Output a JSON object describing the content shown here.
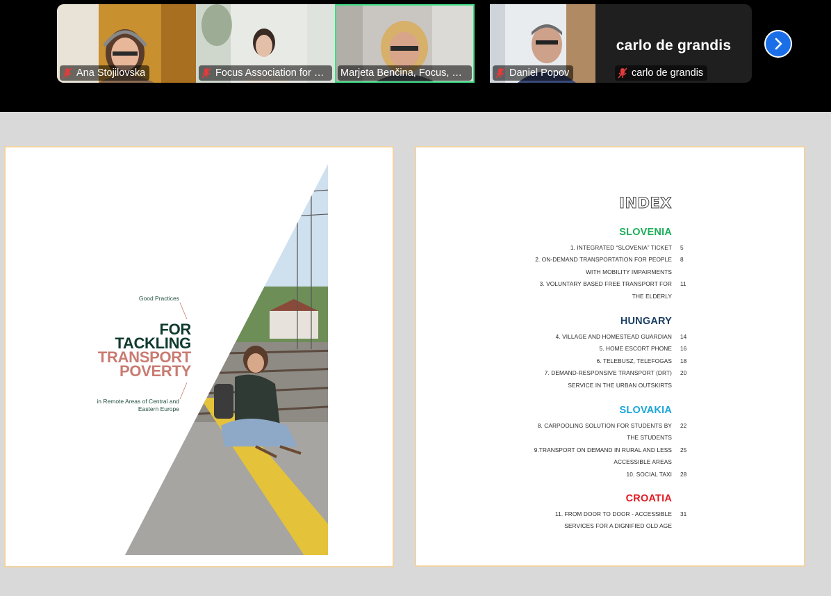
{
  "participants": [
    {
      "name": "Ana Stojilovska",
      "muted": true
    },
    {
      "name": "Focus Association for Sustainable Development",
      "muted": true
    },
    {
      "name": "Marjeta Benčina, Focus, Slovenia",
      "muted": false,
      "active_speaker": true
    },
    {
      "name": "Daniel Popov",
      "muted": true
    },
    {
      "name": "carlo de grandis",
      "display_name": "carlo de grandis",
      "muted": true,
      "video_off": true
    }
  ],
  "colors": {
    "active_speaker_border": "#3ddc84",
    "nav_button": "#1a6fe8",
    "slovenia": "#1fae5b",
    "hungary": "#1b3f63",
    "slovakia": "#1aa5db",
    "croatia": "#e11b22",
    "cover_green": "#0f3b2e",
    "cover_pink": "#c97b72",
    "page_border": "#f2d3a3"
  },
  "cover": {
    "kicker": "Good Practices",
    "line1": "FOR",
    "line2": "TACKLING",
    "line3": "TRANSPORT",
    "line4": "POVERTY",
    "subtitle": "in Remote Areas of Central and Eastern Europe"
  },
  "index": {
    "title": "INDEX",
    "sections": [
      {
        "country": "SLOVENIA",
        "entries": [
          {
            "lines": [
              "1. INTEGRATED “SLOVENIA” TICKET"
            ],
            "page": "5"
          },
          {
            "lines": [
              "2. ON-DEMAND TRANSPORTATION FOR PEOPLE",
              "WITH MOBILITY IMPAIRMENTS"
            ],
            "page": "8"
          },
          {
            "lines": [
              "3. VOLUNTARY BASED FREE TRANSPORT FOR",
              "THE ELDERLY"
            ],
            "page": "11"
          }
        ]
      },
      {
        "country": "HUNGARY",
        "entries": [
          {
            "lines": [
              "4. VILLAGE AND HOMESTEAD GUARDIAN"
            ],
            "page": "14"
          },
          {
            "lines": [
              "5. HOME ESCORT PHONE"
            ],
            "page": "16"
          },
          {
            "lines": [
              "6. TELEBUSZ, TELEFOGAS"
            ],
            "page": "18"
          },
          {
            "lines": [
              "7. DEMAND-RESPONSIVE TRANSPORT (DRT)",
              "SERVICE IN THE URBAN OUTSKIRTS"
            ],
            "page": "20"
          }
        ]
      },
      {
        "country": "SLOVAKIA",
        "entries": [
          {
            "lines": [
              "8. CARPOOLING SOLUTION FOR STUDENTS BY",
              "THE STUDENTS"
            ],
            "page": "22"
          },
          {
            "lines": [
              "9.TRANSPORT ON DEMAND IN RURAL AND LESS",
              "ACCESSIBLE AREAS"
            ],
            "page": "25"
          },
          {
            "lines": [
              "10. SOCIAL TAXI"
            ],
            "page": "28"
          }
        ]
      },
      {
        "country": "CROATIA",
        "entries": [
          {
            "lines": [
              "11. FROM DOOR TO DOOR - ACCESSIBLE",
              "SERVICES FOR A DIGNIFIED OLD AGE"
            ],
            "page": "31"
          }
        ]
      }
    ]
  }
}
